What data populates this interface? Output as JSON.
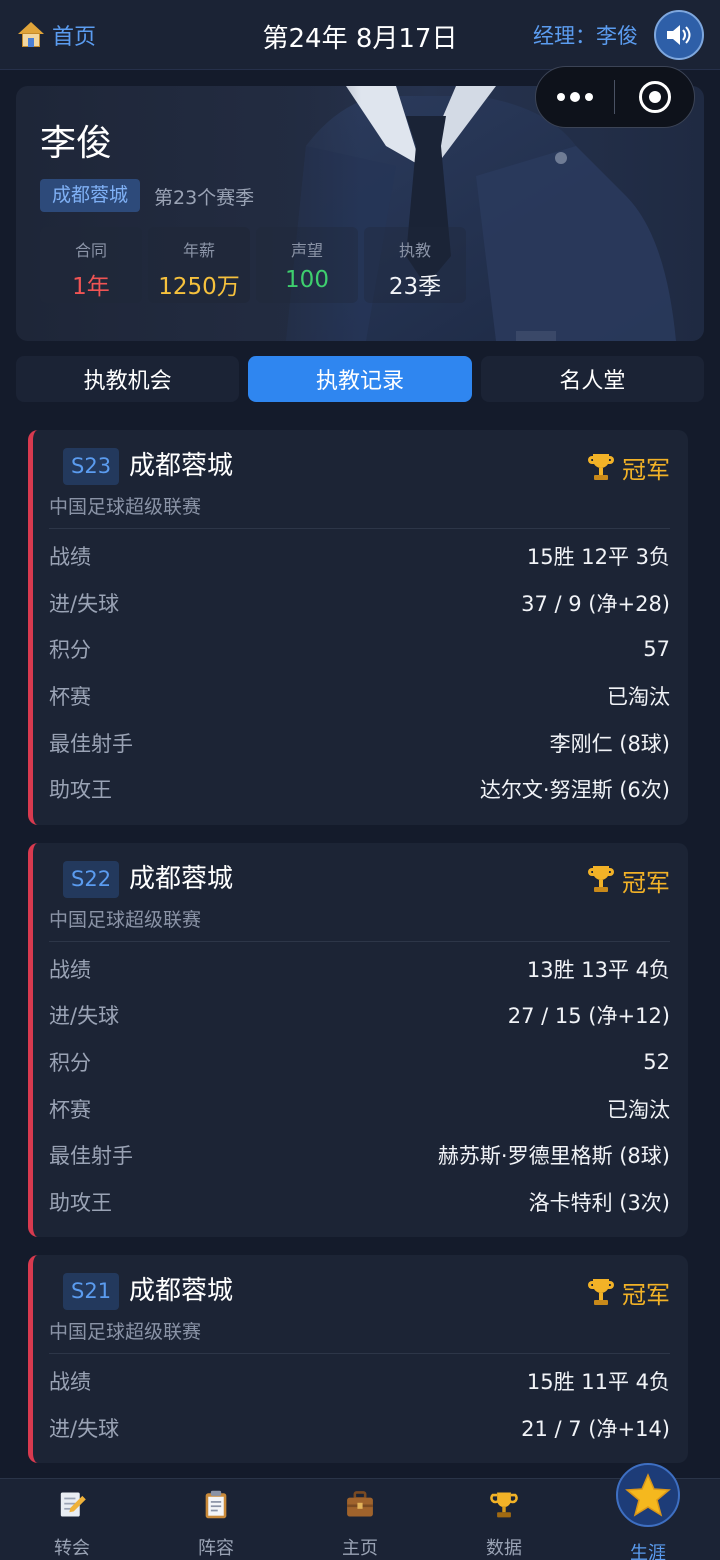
{
  "topbar": {
    "home_label": "首页",
    "date": "第24年 8月17日",
    "manager_label": "经理：李俊"
  },
  "profile": {
    "name": "李俊",
    "team": "成都蓉城",
    "season_text": "第23个赛季",
    "stats": [
      {
        "label": "合同",
        "value": "1年",
        "color": "#f05454"
      },
      {
        "label": "年薪",
        "value": "1250万",
        "color": "#f6c13d"
      },
      {
        "label": "声望",
        "value": "100",
        "color": "#3ecf6e"
      },
      {
        "label": "执教",
        "value": "23季",
        "color": "#f2f4f8"
      }
    ]
  },
  "tabs": [
    {
      "label": "执教机会",
      "active": false
    },
    {
      "label": "执教记录",
      "active": true
    },
    {
      "label": "名人堂",
      "active": false
    }
  ],
  "records": [
    {
      "season": "S23",
      "team": "成都蓉城",
      "result": "冠军",
      "league": "中国足球超级联赛",
      "rows": [
        {
          "k": "战绩",
          "v": "15胜 12平 3负"
        },
        {
          "k": "进/失球",
          "v": "37 / 9 (净+28)"
        },
        {
          "k": "积分",
          "v": "57"
        },
        {
          "k": "杯赛",
          "v": "已淘汰"
        },
        {
          "k": "最佳射手",
          "v": "李刚仁 (8球)"
        },
        {
          "k": "助攻王",
          "v": "达尔文·努涅斯 (6次)"
        }
      ]
    },
    {
      "season": "S22",
      "team": "成都蓉城",
      "result": "冠军",
      "league": "中国足球超级联赛",
      "rows": [
        {
          "k": "战绩",
          "v": "13胜 13平 4负"
        },
        {
          "k": "进/失球",
          "v": "27 / 15 (净+12)"
        },
        {
          "k": "积分",
          "v": "52"
        },
        {
          "k": "杯赛",
          "v": "已淘汰"
        },
        {
          "k": "最佳射手",
          "v": "赫苏斯·罗德里格斯 (8球)"
        },
        {
          "k": "助攻王",
          "v": "洛卡特利 (3次)"
        }
      ]
    },
    {
      "season": "S21",
      "team": "成都蓉城",
      "result": "冠军",
      "league": "中国足球超级联赛",
      "rows": [
        {
          "k": "战绩",
          "v": "15胜 11平 4负"
        },
        {
          "k": "进/失球",
          "v": "21 / 7 (净+14)"
        }
      ]
    }
  ],
  "nav": [
    {
      "label": "转会",
      "icon": "memo-pencil-icon",
      "active": false
    },
    {
      "label": "阵容",
      "icon": "clipboard-icon",
      "active": false
    },
    {
      "label": "主页",
      "icon": "briefcase-icon",
      "active": false
    },
    {
      "label": "数据",
      "icon": "trophy-icon",
      "active": false
    },
    {
      "label": "生涯",
      "icon": "star-icon",
      "active": true
    }
  ],
  "colors": {
    "accent": "#2f86f0",
    "champion": "#f2b227",
    "record_border": "#d83a4f",
    "background": "#141b2b"
  }
}
